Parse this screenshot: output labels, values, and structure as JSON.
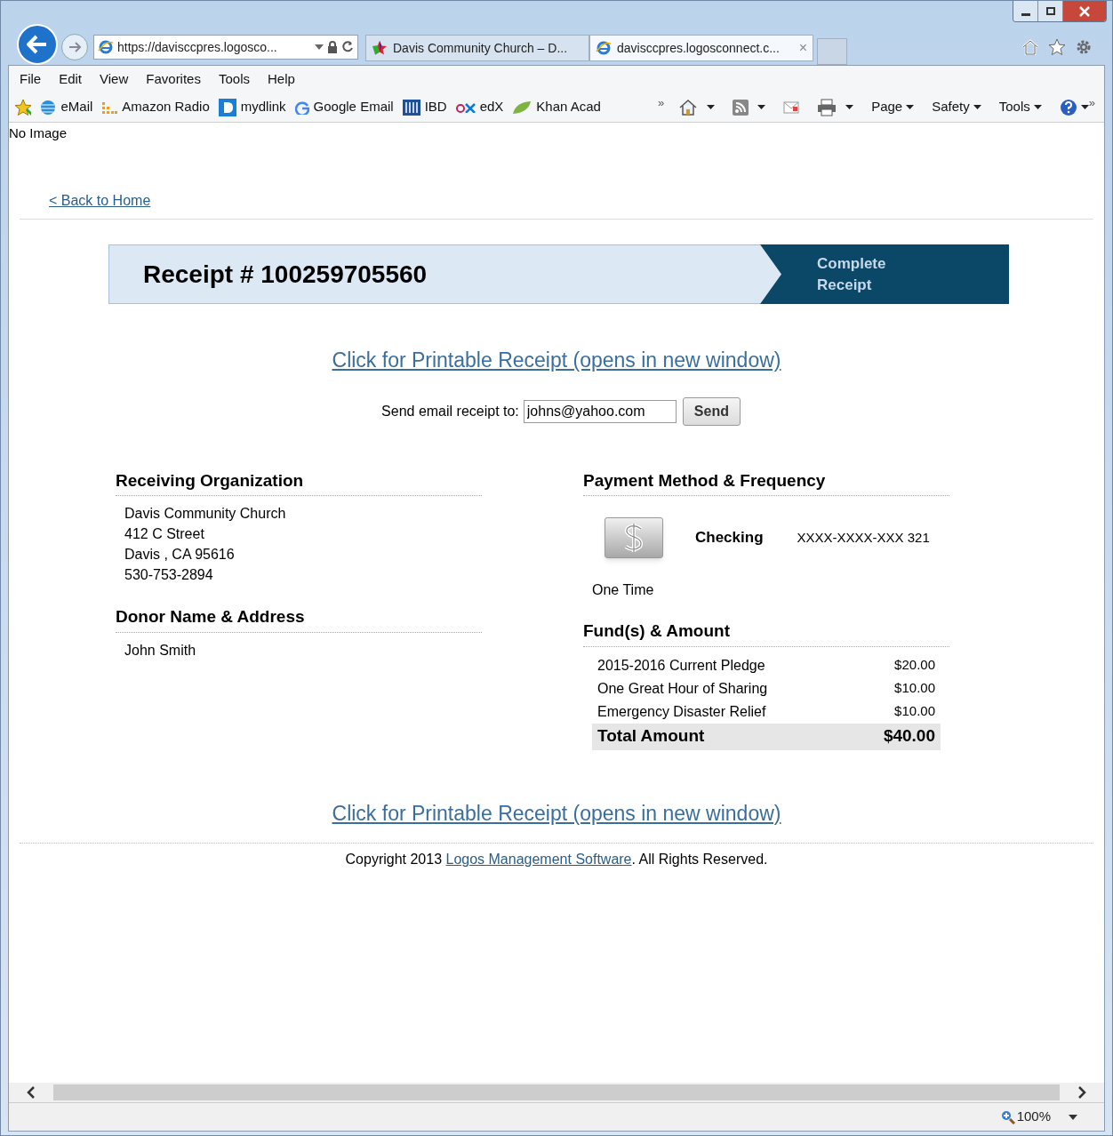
{
  "address_bar": {
    "url": "https://davisccpres.logosco..."
  },
  "tabs": [
    {
      "title": "Davis Community Church – D...",
      "selected": false,
      "closable": false
    },
    {
      "title": "davisccpres.logosconnect.c...",
      "selected": true,
      "closable": true
    }
  ],
  "close_glyph": "×",
  "menu": [
    "File",
    "Edit",
    "View",
    "Favorites",
    "Tools",
    "Help"
  ],
  "favorites": [
    "eMail",
    "Amazon Radio",
    "mydlink",
    "Google Email",
    "IBD",
    "edX",
    "Khan Acad"
  ],
  "chevron": "»",
  "command_bar": [
    "Page",
    "Safety",
    "Tools"
  ],
  "page": {
    "image_alt": "No Image",
    "back_link": "< Back to Home",
    "receipt_title": "Receipt # 100259705560",
    "step": [
      "Complete",
      "Receipt"
    ],
    "printable_link": "Click for Printable Receipt (opens in new window)",
    "email_label": "Send email receipt to:",
    "email_value": "johns@yahoo.com",
    "send_button": "Send",
    "receiving": {
      "heading": "Receiving Organization",
      "lines": [
        "Davis Community Church",
        "412 C Street",
        "Davis , CA 95616",
        "530-753-2894"
      ]
    },
    "donor": {
      "heading": "Donor Name & Address",
      "lines": [
        "John Smith"
      ]
    },
    "payment": {
      "heading": "Payment Method & Frequency",
      "method": "Checking",
      "account": "XXXX-XXXX-XXX 321",
      "frequency": "One Time"
    },
    "funds": {
      "heading": "Fund(s) & Amount",
      "rows": [
        {
          "name": "2015-2016 Current Pledge",
          "amount": "$20.00"
        },
        {
          "name": "One Great Hour of Sharing",
          "amount": "$10.00"
        },
        {
          "name": "Emergency Disaster Relief",
          "amount": "$10.00"
        }
      ],
      "total_label": "Total Amount",
      "total": "$40.00"
    },
    "printable_link_bottom": "Click for Printable Receipt (opens in new window)",
    "copyright": {
      "before": "Copyright 2013 ",
      "link": "Logos Management Software",
      "after": ". All Rights Reserved."
    }
  },
  "status_bar": {
    "zoom": "100%"
  }
}
